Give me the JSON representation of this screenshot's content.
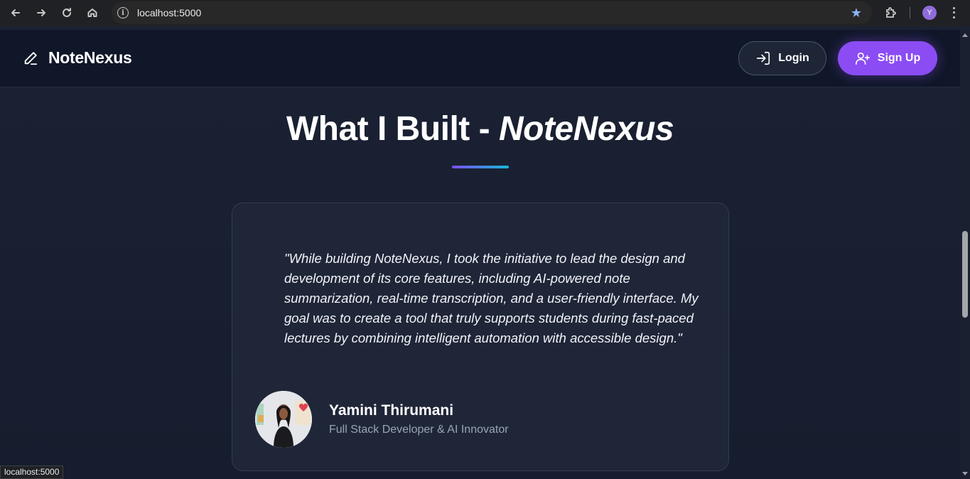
{
  "browser": {
    "url": "localhost:5000",
    "profile_initial": "Y",
    "status_text": "localhost:5000",
    "icons": [
      "back-icon",
      "forward-icon",
      "reload-icon",
      "home-icon",
      "site-info-icon",
      "bookmark-star-icon",
      "extensions-icon",
      "menu-icon"
    ]
  },
  "header": {
    "brand_name": "NoteNexus",
    "login_label": "Login",
    "signup_label": "Sign Up"
  },
  "section": {
    "title_prefix": "What I Built - ",
    "title_emphasis": "NoteNexus"
  },
  "testimonial": {
    "quote": "\"While building NoteNexus, I took the initiative to lead the design and development of its core features, including AI-powered note summarization, real-time transcription, and a user-friendly interface. My goal was to create a tool that truly supports students during fast-paced lectures by combining intelligent automation with accessible design.\"",
    "author_name": "Yamini Thirumani",
    "author_role": "Full Stack Developer & AI Innovator"
  },
  "colors": {
    "accent_purple": "#8b4cf4",
    "underline_start": "#7c4ff0",
    "underline_end": "#14b8d6",
    "header_bg": "#101728",
    "page_bg": "#1b2233",
    "card_bg": "#1f2638"
  }
}
